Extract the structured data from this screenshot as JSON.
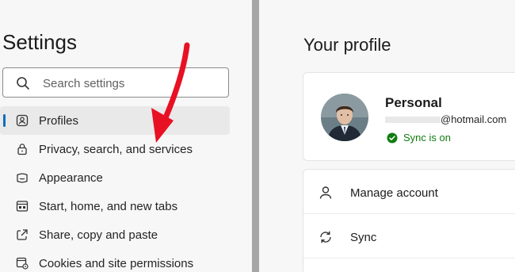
{
  "sidebar": {
    "title": "Settings",
    "search_placeholder": "Search settings",
    "items": [
      {
        "label": "Profiles",
        "icon": "profiles-icon",
        "active": true
      },
      {
        "label": "Privacy, search, and services",
        "icon": "lock-icon",
        "active": false
      },
      {
        "label": "Appearance",
        "icon": "appearance-icon",
        "active": false
      },
      {
        "label": "Start, home, and new tabs",
        "icon": "start-home-icon",
        "active": false
      },
      {
        "label": "Share, copy and paste",
        "icon": "share-icon",
        "active": false
      },
      {
        "label": "Cookies and site permissions",
        "icon": "cookies-icon",
        "active": false
      }
    ]
  },
  "main": {
    "title": "Your profile",
    "profile": {
      "name": "Personal",
      "email": "@hotmail.com",
      "sync_status": "Sync is on"
    },
    "actions": [
      {
        "label": "Manage account",
        "icon": "person-icon"
      },
      {
        "label": "Sync",
        "icon": "sync-icon"
      }
    ]
  },
  "colors": {
    "accent": "#0f6cbd",
    "sync_green": "#107c10",
    "annotation_red": "#e81123"
  }
}
